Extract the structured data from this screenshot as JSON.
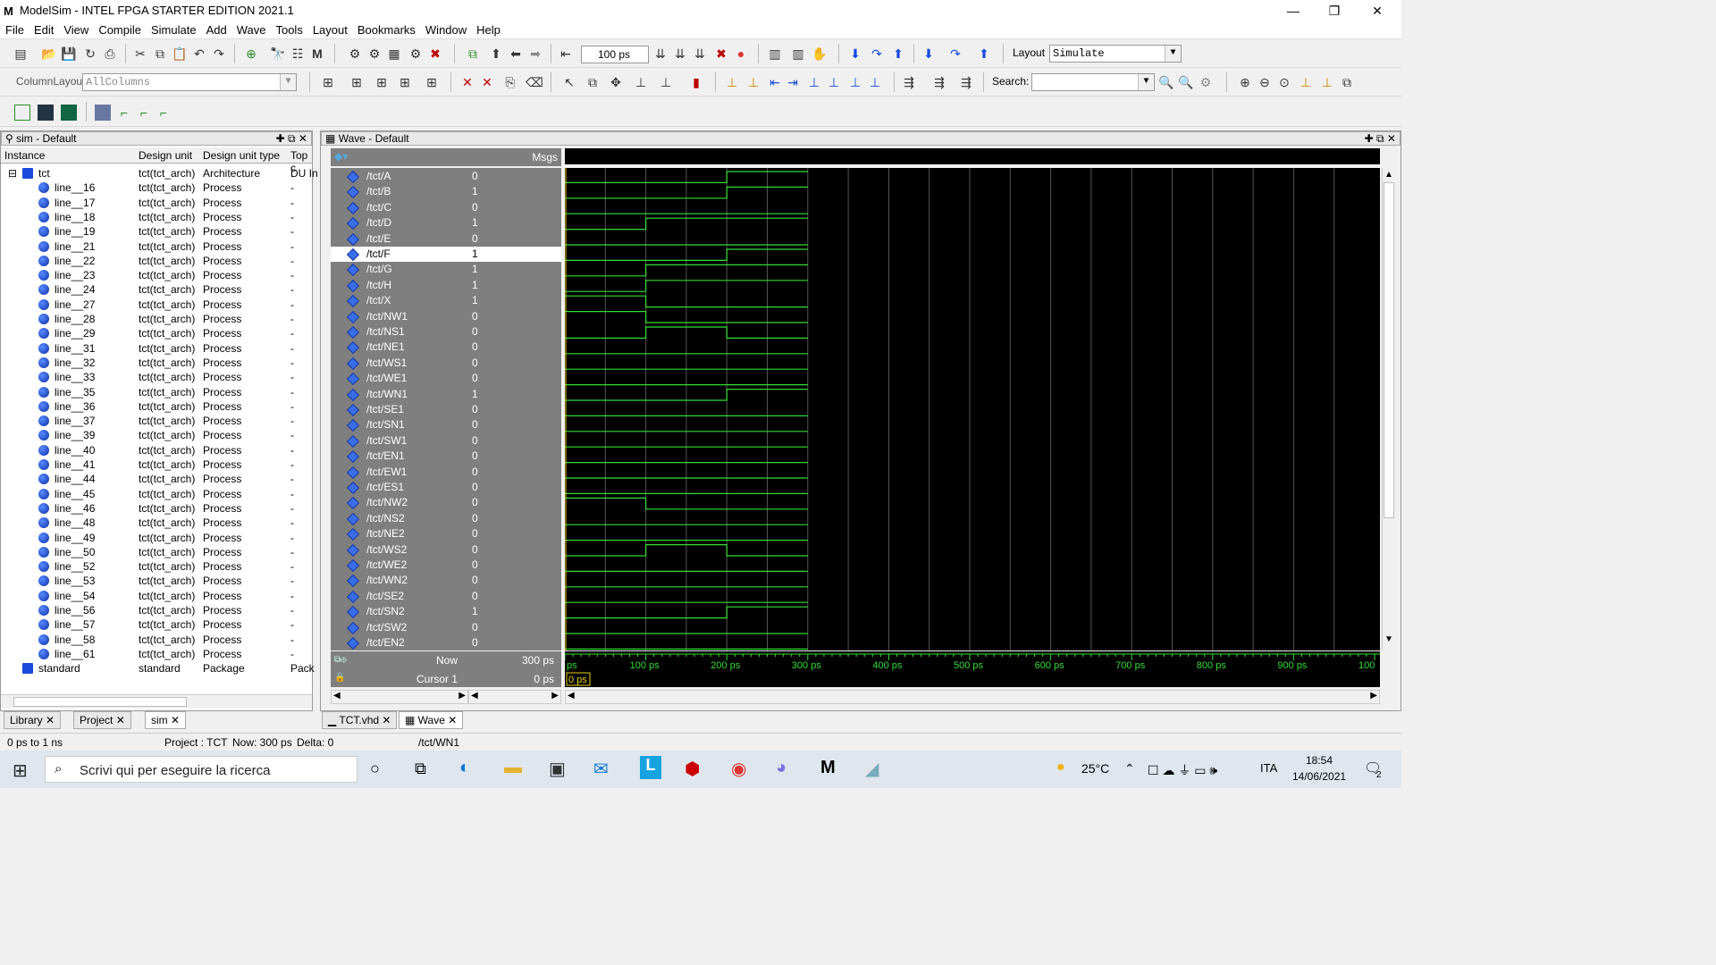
{
  "app": {
    "title": "ModelSim - INTEL FPGA STARTER EDITION 2021.1",
    "logo": "M"
  },
  "window_controls": {
    "minimize": "—",
    "restore": "❐",
    "close": "✕"
  },
  "menu": [
    "File",
    "Edit",
    "View",
    "Compile",
    "Simulate",
    "Add",
    "Wave",
    "Tools",
    "Layout",
    "Bookmarks",
    "Window",
    "Help"
  ],
  "toolbar": {
    "time_value": "100 ps",
    "layout_label": "Layout",
    "layout_value": "Simulate",
    "columnlayout_label": "ColumnLayout",
    "columnlayout_value": "AllColumns",
    "search_label": "Search:",
    "search_value": ""
  },
  "sim_panel": {
    "title": "sim - Default",
    "columns": [
      "Instance",
      "Design unit",
      "Design unit type",
      "Top c"
    ],
    "rows": [
      {
        "instance": "tct",
        "unit": "tct(tct_arch)",
        "type": "Architecture",
        "top": "DU In",
        "level": 0
      },
      {
        "instance": "line__16",
        "unit": "tct(tct_arch)",
        "type": "Process",
        "top": "-",
        "level": 1
      },
      {
        "instance": "line__17",
        "unit": "tct(tct_arch)",
        "type": "Process",
        "top": "-",
        "level": 1
      },
      {
        "instance": "line__18",
        "unit": "tct(tct_arch)",
        "type": "Process",
        "top": "-",
        "level": 1
      },
      {
        "instance": "line__19",
        "unit": "tct(tct_arch)",
        "type": "Process",
        "top": "-",
        "level": 1
      },
      {
        "instance": "line__21",
        "unit": "tct(tct_arch)",
        "type": "Process",
        "top": "-",
        "level": 1
      },
      {
        "instance": "line__22",
        "unit": "tct(tct_arch)",
        "type": "Process",
        "top": "-",
        "level": 1
      },
      {
        "instance": "line__23",
        "unit": "tct(tct_arch)",
        "type": "Process",
        "top": "-",
        "level": 1
      },
      {
        "instance": "line__24",
        "unit": "tct(tct_arch)",
        "type": "Process",
        "top": "-",
        "level": 1
      },
      {
        "instance": "line__27",
        "unit": "tct(tct_arch)",
        "type": "Process",
        "top": "-",
        "level": 1
      },
      {
        "instance": "line__28",
        "unit": "tct(tct_arch)",
        "type": "Process",
        "top": "-",
        "level": 1
      },
      {
        "instance": "line__29",
        "unit": "tct(tct_arch)",
        "type": "Process",
        "top": "-",
        "level": 1
      },
      {
        "instance": "line__31",
        "unit": "tct(tct_arch)",
        "type": "Process",
        "top": "-",
        "level": 1
      },
      {
        "instance": "line__32",
        "unit": "tct(tct_arch)",
        "type": "Process",
        "top": "-",
        "level": 1
      },
      {
        "instance": "line__33",
        "unit": "tct(tct_arch)",
        "type": "Process",
        "top": "-",
        "level": 1
      },
      {
        "instance": "line__35",
        "unit": "tct(tct_arch)",
        "type": "Process",
        "top": "-",
        "level": 1
      },
      {
        "instance": "line__36",
        "unit": "tct(tct_arch)",
        "type": "Process",
        "top": "-",
        "level": 1
      },
      {
        "instance": "line__37",
        "unit": "tct(tct_arch)",
        "type": "Process",
        "top": "-",
        "level": 1
      },
      {
        "instance": "line__39",
        "unit": "tct(tct_arch)",
        "type": "Process",
        "top": "-",
        "level": 1
      },
      {
        "instance": "line__40",
        "unit": "tct(tct_arch)",
        "type": "Process",
        "top": "-",
        "level": 1
      },
      {
        "instance": "line__41",
        "unit": "tct(tct_arch)",
        "type": "Process",
        "top": "-",
        "level": 1
      },
      {
        "instance": "line__44",
        "unit": "tct(tct_arch)",
        "type": "Process",
        "top": "-",
        "level": 1
      },
      {
        "instance": "line__45",
        "unit": "tct(tct_arch)",
        "type": "Process",
        "top": "-",
        "level": 1
      },
      {
        "instance": "line__46",
        "unit": "tct(tct_arch)",
        "type": "Process",
        "top": "-",
        "level": 1
      },
      {
        "instance": "line__48",
        "unit": "tct(tct_arch)",
        "type": "Process",
        "top": "-",
        "level": 1
      },
      {
        "instance": "line__49",
        "unit": "tct(tct_arch)",
        "type": "Process",
        "top": "-",
        "level": 1
      },
      {
        "instance": "line__50",
        "unit": "tct(tct_arch)",
        "type": "Process",
        "top": "-",
        "level": 1
      },
      {
        "instance": "line__52",
        "unit": "tct(tct_arch)",
        "type": "Process",
        "top": "-",
        "level": 1
      },
      {
        "instance": "line__53",
        "unit": "tct(tct_arch)",
        "type": "Process",
        "top": "-",
        "level": 1
      },
      {
        "instance": "line__54",
        "unit": "tct(tct_arch)",
        "type": "Process",
        "top": "-",
        "level": 1
      },
      {
        "instance": "line__56",
        "unit": "tct(tct_arch)",
        "type": "Process",
        "top": "-",
        "level": 1
      },
      {
        "instance": "line__57",
        "unit": "tct(tct_arch)",
        "type": "Process",
        "top": "-",
        "level": 1
      },
      {
        "instance": "line__58",
        "unit": "tct(tct_arch)",
        "type": "Process",
        "top": "-",
        "level": 1
      },
      {
        "instance": "line__61",
        "unit": "tct(tct_arch)",
        "type": "Process",
        "top": "-",
        "level": 1
      },
      {
        "instance": "standard",
        "unit": "standard",
        "type": "Package",
        "top": "Pack",
        "level": 0
      }
    ],
    "tabs": [
      "Library",
      "Project",
      "sim"
    ]
  },
  "wave_panel": {
    "title": "Wave - Default",
    "msgs_label": "Msgs",
    "signals": [
      {
        "name": "/tct/A",
        "value": "0",
        "wave": [
          0,
          0,
          1
        ]
      },
      {
        "name": "/tct/B",
        "value": "1",
        "wave": [
          0,
          0,
          1
        ]
      },
      {
        "name": "/tct/C",
        "value": "0",
        "wave": [
          0,
          0,
          0
        ]
      },
      {
        "name": "/tct/D",
        "value": "1",
        "wave": [
          0,
          1,
          1
        ]
      },
      {
        "name": "/tct/E",
        "value": "0",
        "wave": [
          0,
          0,
          0
        ]
      },
      {
        "name": "/tct/F",
        "value": "1",
        "wave": [
          0,
          0,
          1
        ],
        "selected": true
      },
      {
        "name": "/tct/G",
        "value": "1",
        "wave": [
          0,
          1,
          1
        ]
      },
      {
        "name": "/tct/H",
        "value": "1",
        "wave": [
          0,
          1,
          1
        ]
      },
      {
        "name": "/tct/X",
        "value": "1",
        "wave": [
          1,
          0,
          0
        ]
      },
      {
        "name": "/tct/NW1",
        "value": "0",
        "wave": [
          1,
          0,
          0
        ]
      },
      {
        "name": "/tct/NS1",
        "value": "0",
        "wave": [
          0,
          1,
          0
        ]
      },
      {
        "name": "/tct/NE1",
        "value": "0",
        "wave": [
          0,
          0,
          0
        ]
      },
      {
        "name": "/tct/WS1",
        "value": "0",
        "wave": [
          0,
          0,
          0
        ]
      },
      {
        "name": "/tct/WE1",
        "value": "0",
        "wave": [
          0,
          0,
          0
        ]
      },
      {
        "name": "/tct/WN1",
        "value": "1",
        "wave": [
          0,
          0,
          1
        ]
      },
      {
        "name": "/tct/SE1",
        "value": "0",
        "wave": [
          0,
          0,
          0
        ]
      },
      {
        "name": "/tct/SN1",
        "value": "0",
        "wave": [
          0,
          0,
          0
        ]
      },
      {
        "name": "/tct/SW1",
        "value": "0",
        "wave": [
          0,
          0,
          0
        ]
      },
      {
        "name": "/tct/EN1",
        "value": "0",
        "wave": [
          0,
          0,
          0
        ]
      },
      {
        "name": "/tct/EW1",
        "value": "0",
        "wave": [
          0,
          0,
          0
        ]
      },
      {
        "name": "/tct/ES1",
        "value": "0",
        "wave": [
          0,
          0,
          0
        ]
      },
      {
        "name": "/tct/NW2",
        "value": "0",
        "wave": [
          1,
          0,
          0
        ]
      },
      {
        "name": "/tct/NS2",
        "value": "0",
        "wave": [
          0,
          0,
          0
        ]
      },
      {
        "name": "/tct/NE2",
        "value": "0",
        "wave": [
          0,
          0,
          0
        ]
      },
      {
        "name": "/tct/WS2",
        "value": "0",
        "wave": [
          0,
          1,
          0
        ]
      },
      {
        "name": "/tct/WE2",
        "value": "0",
        "wave": [
          0,
          0,
          0
        ]
      },
      {
        "name": "/tct/WN2",
        "value": "0",
        "wave": [
          0,
          0,
          0
        ]
      },
      {
        "name": "/tct/SE2",
        "value": "0",
        "wave": [
          0,
          0,
          0
        ]
      },
      {
        "name": "/tct/SN2",
        "value": "1",
        "wave": [
          0,
          0,
          1
        ]
      },
      {
        "name": "/tct/SW2",
        "value": "0",
        "wave": [
          0,
          0,
          0
        ]
      },
      {
        "name": "/tct/EN2",
        "value": "0",
        "wave": [
          0,
          0,
          0
        ]
      }
    ],
    "sim_end_ps": 300,
    "view_range_ps": 1000,
    "now_label": "Now",
    "now_value": "300 ps",
    "cursor_label": "Cursor 1",
    "cursor_value": "0 ps",
    "cursor_marker": "0 ps",
    "timeline_labels": [
      "ps",
      "100 ps",
      "200 ps",
      "300 ps",
      "400 ps",
      "500 ps",
      "600 ps",
      "700 ps",
      "800 ps",
      "900 ps",
      "100"
    ],
    "tabs": [
      "TCT.vhd",
      "Wave"
    ]
  },
  "status": {
    "range": "0 ps to 1 ns",
    "project": "Project : TCT",
    "now": "Now: 300 ps",
    "delta": "Delta: 0",
    "selected_signal": "/tct/WN1"
  },
  "taskbar": {
    "search_placeholder": "Scrivi qui per eseguire la ricerca",
    "temperature": "25°C",
    "language": "ITA",
    "time": "18:54",
    "date": "14/06/2021",
    "notification_count": "2"
  },
  "colors": {
    "wave_green": "#33dd33",
    "wave_bg": "#000000",
    "names_bg": "#7f7f7f",
    "cursor_yellow": "#e8d000"
  }
}
